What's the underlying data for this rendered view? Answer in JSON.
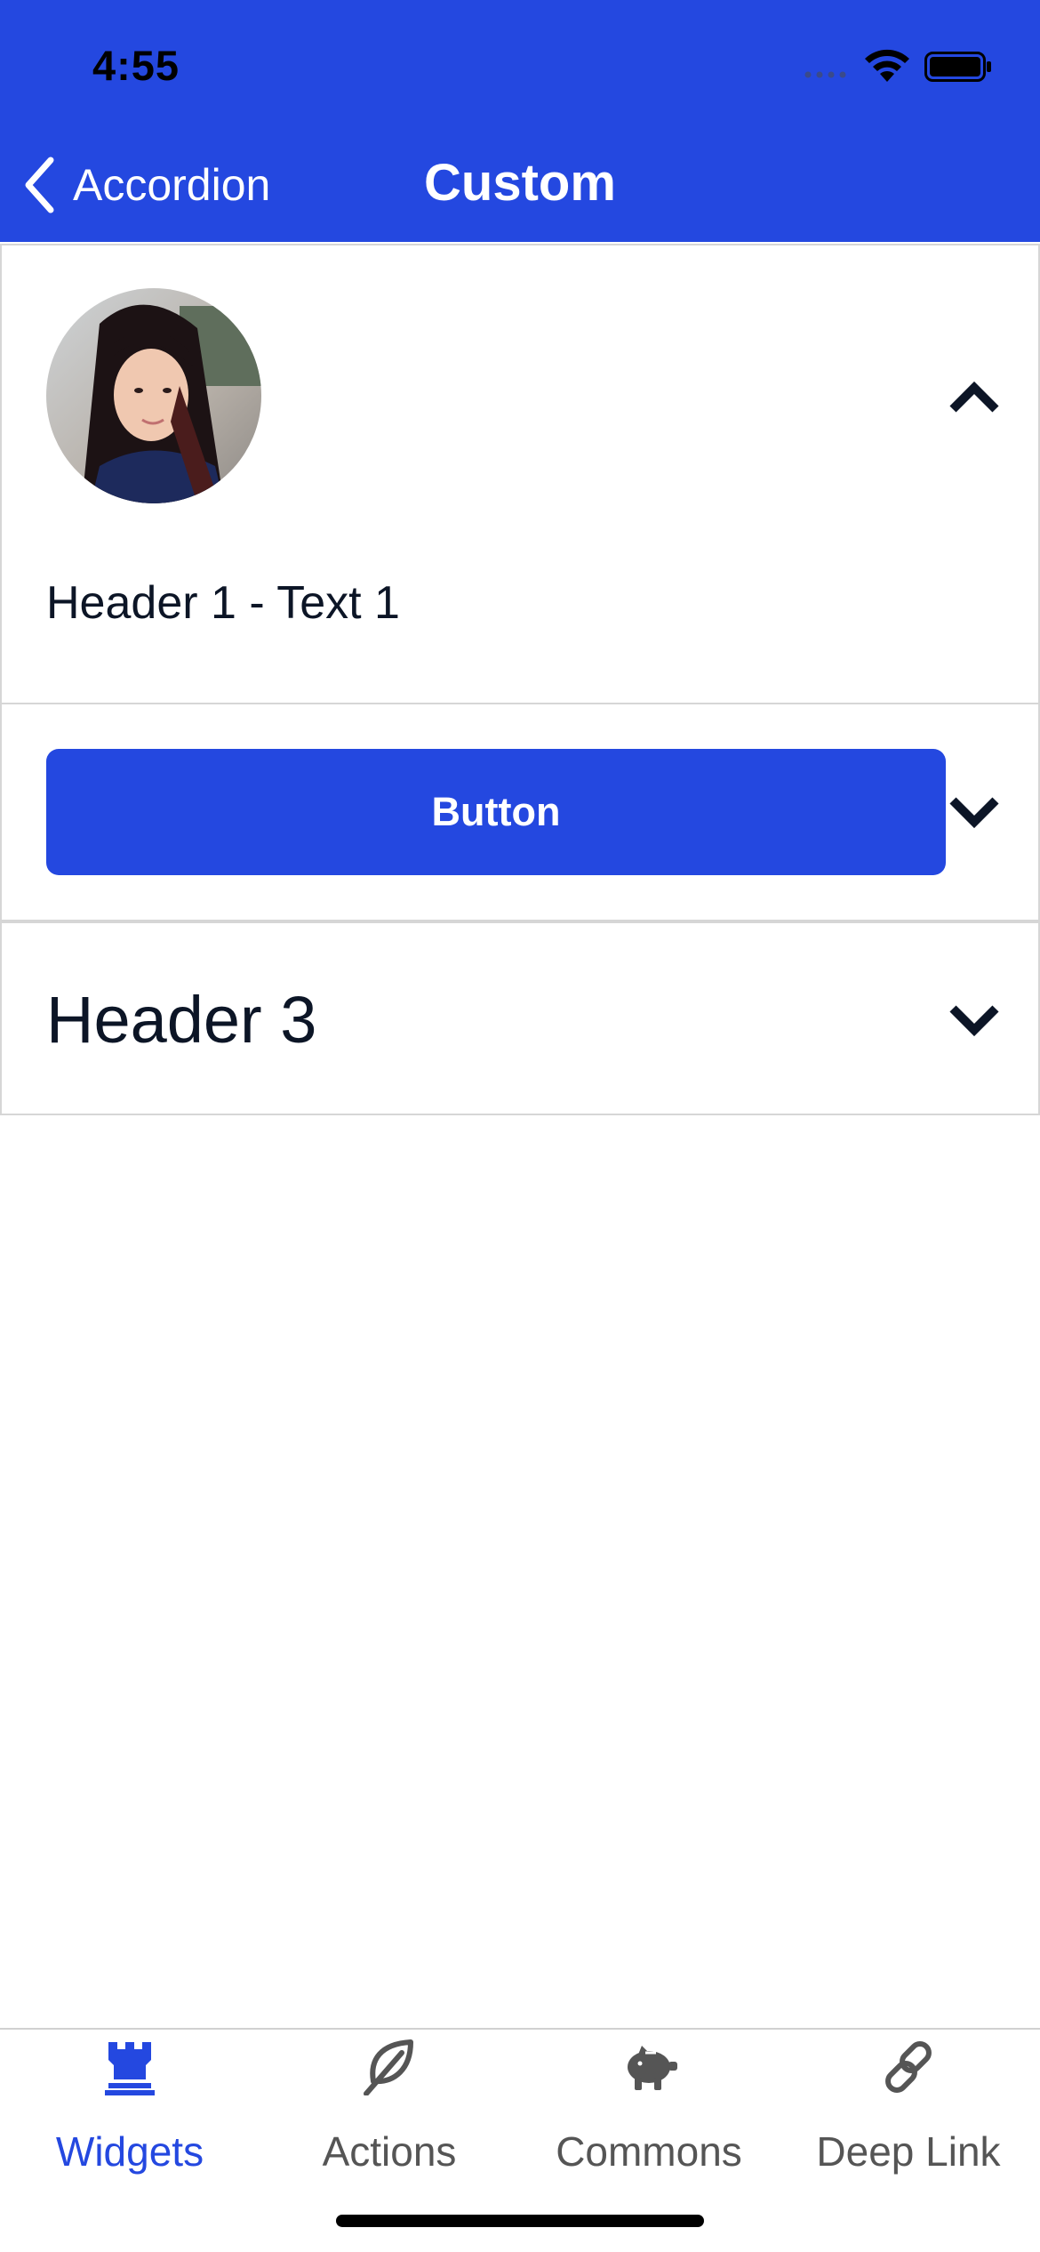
{
  "status_bar": {
    "time": "4:55"
  },
  "nav": {
    "back_label": "Accordion",
    "title": "Custom"
  },
  "accordion": {
    "items": [
      {
        "text": "Header 1 - Text 1",
        "expanded": true
      },
      {
        "button_label": "Button",
        "expanded": false
      },
      {
        "title": "Header 3",
        "expanded": false
      }
    ]
  },
  "tabbar": {
    "items": [
      {
        "label": "Widgets",
        "icon": "rook-icon",
        "active": true
      },
      {
        "label": "Actions",
        "icon": "leaf-icon",
        "active": false
      },
      {
        "label": "Commons",
        "icon": "piggy-bank-icon",
        "active": false
      },
      {
        "label": "Deep Link",
        "icon": "link-icon",
        "active": false
      }
    ]
  },
  "colors": {
    "primary": "#2448e0",
    "text_dark": "#0c1526",
    "tab_inactive": "#555555",
    "divider": "#d6d6d6"
  }
}
